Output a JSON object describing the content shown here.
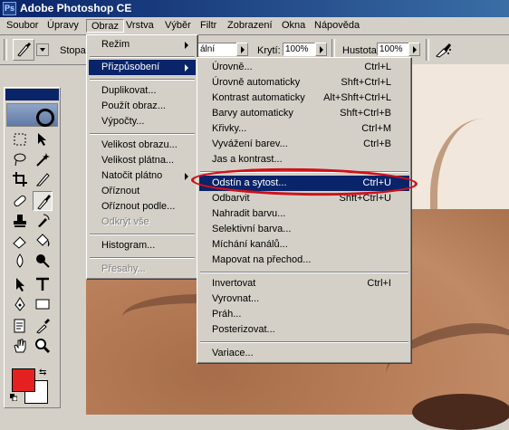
{
  "app": {
    "title": "Adobe Photoshop CE"
  },
  "menubar": [
    "Soubor",
    "Úpravy",
    "Obraz",
    "Vrstva",
    "Výběr",
    "Filtr",
    "Zobrazení",
    "Okna",
    "Nápověda"
  ],
  "options": {
    "stopa_label": "Stopa",
    "mode_value": "ální",
    "opacity_label": "Krytí:",
    "opacity_value": "100%",
    "flow_label": "Hustota:",
    "flow_value": "100%"
  },
  "obraz_menu": {
    "items": [
      {
        "label": "Režim",
        "submenu": true
      },
      {
        "label": "Přizpůsobení",
        "submenu": true,
        "highlighted": true
      },
      {
        "label": "Duplikovat..."
      },
      {
        "label": "Použít obraz..."
      },
      {
        "label": "Výpočty..."
      },
      {
        "label": "Velikost obrazu..."
      },
      {
        "label": "Velikost plátna..."
      },
      {
        "label": "Natočit plátno",
        "submenu": true
      },
      {
        "label": "Oříznout"
      },
      {
        "label": "Oříznout podle..."
      },
      {
        "label": "Odkrýt vše",
        "disabled": true
      },
      {
        "label": "Histogram..."
      },
      {
        "label": "Přesahy...",
        "disabled": true
      }
    ]
  },
  "adjust_menu": {
    "items": [
      {
        "label": "Úrovně...",
        "shortcut": "Ctrl+L"
      },
      {
        "label": "Úrovně automaticky",
        "shortcut": "Shft+Ctrl+L"
      },
      {
        "label": "Kontrast automaticky",
        "shortcut": "Alt+Shft+Ctrl+L"
      },
      {
        "label": "Barvy automaticky",
        "shortcut": "Shft+Ctrl+B"
      },
      {
        "label": "Křivky...",
        "shortcut": "Ctrl+M"
      },
      {
        "label": "Vyvážení barev...",
        "shortcut": "Ctrl+B"
      },
      {
        "label": "Jas a kontrast...",
        "shortcut": ""
      },
      {
        "label": "Odstín a sytost...",
        "shortcut": "Ctrl+U",
        "highlighted": true
      },
      {
        "label": "Odbarvit",
        "shortcut": "Shft+Ctrl+U"
      },
      {
        "label": "Nahradit barvu...",
        "shortcut": ""
      },
      {
        "label": "Selektivní barva...",
        "shortcut": ""
      },
      {
        "label": "Míchání kanálů...",
        "shortcut": ""
      },
      {
        "label": "Mapovat na přechod...",
        "shortcut": ""
      },
      {
        "label": "Invertovat",
        "shortcut": "Ctrl+I"
      },
      {
        "label": "Vyrovnat...",
        "shortcut": ""
      },
      {
        "label": "Práh...",
        "shortcut": ""
      },
      {
        "label": "Posterizovat...",
        "shortcut": ""
      },
      {
        "label": "Variace...",
        "shortcut": ""
      }
    ]
  },
  "colors": {
    "foreground": "#e52020",
    "background": "#ffffff",
    "highlight": "#0a246a",
    "annotation": "#d0101a"
  }
}
